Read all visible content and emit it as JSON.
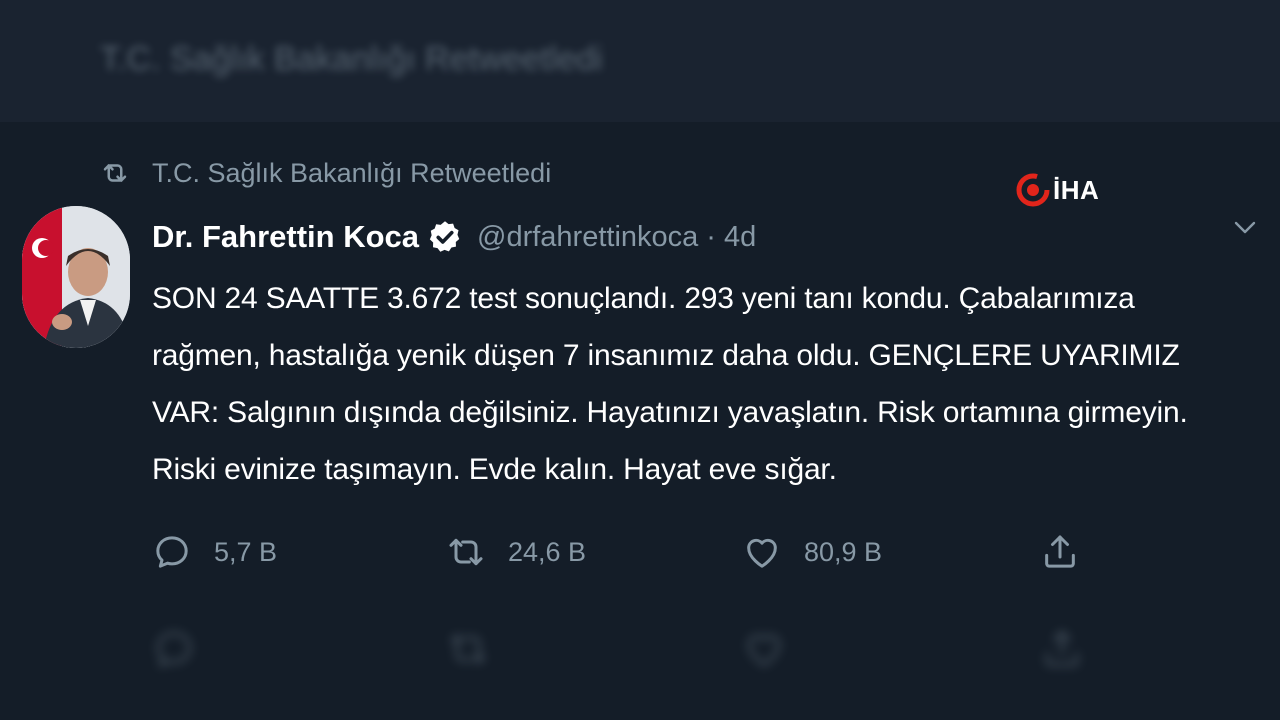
{
  "previous_tweet": {
    "header_text": "T.C. Sağlık Bakanlığı Retweetledi"
  },
  "watermark": {
    "logo_text": "İHA",
    "accent_color": "#e1251b"
  },
  "tweet": {
    "retweeted_by": "T.C. Sağlık Bakanlığı Retweetledi",
    "author_name": "Dr. Fahrettin Koca",
    "verified": true,
    "handle": "@drfahrettinkoca",
    "separator": "·",
    "time": "4d",
    "text_lines": [
      "SON 24 SAATTE 3.672 test sonuçlandı. 293 yeni tanı kondu. Çabalarımıza",
      "rağmen, hastalığa yenik düşen 7 insanımız daha oldu. GENÇLERE UYARIMIZ",
      "VAR: Salgının dışında değilsiniz. Hayatınızı yavaşlatın. Risk ortamına girmeyin.",
      "Riski evinize taşımayın. Evde kalın. Hayat eve sığar."
    ],
    "actions": {
      "reply_count": "5,7 B",
      "retweet_count": "24,6 B",
      "like_count": "80,9 B"
    }
  },
  "colors": {
    "background": "#141d28",
    "secondary_text": "#8899a6",
    "primary_text": "#ffffff"
  },
  "icons": {
    "retweet": "retweet-icon",
    "verified": "verified-badge-icon",
    "caret": "chevron-down-icon",
    "reply": "reply-icon",
    "like": "heart-icon",
    "share": "share-icon"
  }
}
